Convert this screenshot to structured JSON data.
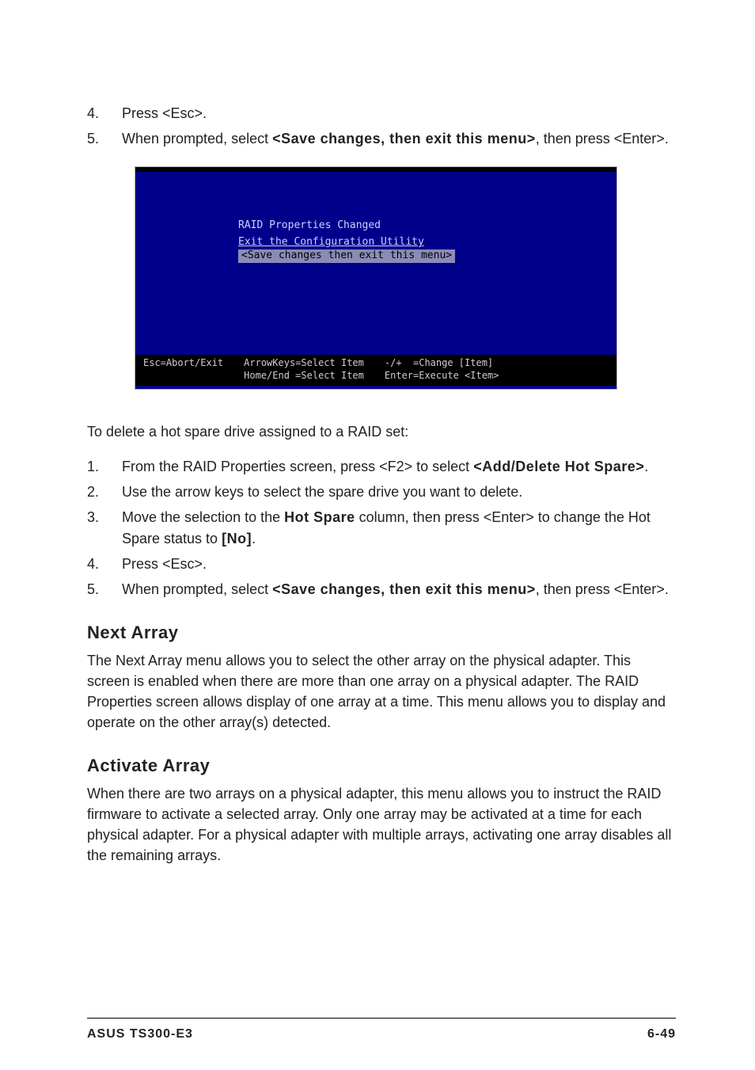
{
  "steps_a": [
    {
      "num": "4.",
      "parts": [
        {
          "t": "Press <Esc>."
        }
      ]
    },
    {
      "num": "5.",
      "parts": [
        {
          "t": "When prompted, select "
        },
        {
          "t": "<Save changes, then exit this menu>",
          "bold": true
        },
        {
          "t": ", then press <Enter>."
        }
      ]
    }
  ],
  "screenshot": {
    "title": "RAID Properties Changed",
    "subtitle": "Exit the Configuration Utility",
    "selected": "<Save changes then exit this menu>",
    "bottom": {
      "c1": "Esc=Abort/Exit",
      "c2": "ArrowKeys=Select Item\nHome/End =Select Item",
      "c3": "-/+  =Change [Item]\nEnter=Execute <Item>"
    }
  },
  "intro_delete": "To delete a hot spare drive assigned to a RAID set:",
  "steps_b": [
    {
      "num": "1.",
      "parts": [
        {
          "t": "From the RAID Properties screen, press <F2> to select "
        },
        {
          "t": "<Add/Delete Hot Spare>",
          "bold": true
        },
        {
          "t": "."
        }
      ]
    },
    {
      "num": "2.",
      "parts": [
        {
          "t": "Use the arrow keys to select the spare drive you want to delete."
        }
      ]
    },
    {
      "num": "3.",
      "parts": [
        {
          "t": "Move the selection to the "
        },
        {
          "t": "Hot Spare",
          "bold": true
        },
        {
          "t": " column, then press <Enter> to change the Hot Spare status to "
        },
        {
          "t": "[No]",
          "bold": true
        },
        {
          "t": "."
        }
      ]
    },
    {
      "num": "4.",
      "parts": [
        {
          "t": "Press <Esc>."
        }
      ]
    },
    {
      "num": "5.",
      "parts": [
        {
          "t": "When prompted, select "
        },
        {
          "t": "<Save changes, then exit this menu>",
          "bold": true
        },
        {
          "t": ", then press <Enter>."
        }
      ]
    }
  ],
  "sections": {
    "next_array": {
      "title": "Next Array",
      "body": "The Next Array menu allows you to select the other array on the physical adapter. This screen is enabled when there are more than one array on a physical adapter. The RAID Properties screen allows display of one array at a time. This menu allows you to display and operate on the other array(s) detected."
    },
    "activate_array": {
      "title": "Activate Array",
      "body": "When there are two arrays on a physical adapter, this menu allows you to instruct the RAID firmware to activate a selected array. Only one array may be activated at a time for each physical adapter. For a physical adapter with multiple arrays, activating one array disables all the remaining arrays."
    }
  },
  "footer": {
    "left": "ASUS TS300-E3",
    "right": "6-49"
  }
}
